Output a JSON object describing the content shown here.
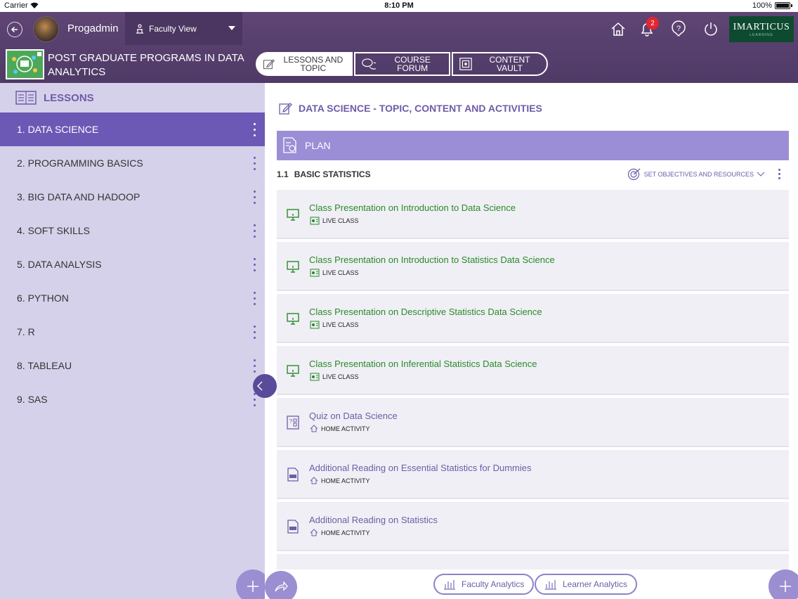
{
  "status_bar": {
    "carrier": "Carrier",
    "time": "8:10 PM",
    "battery": "100%"
  },
  "header": {
    "username": "Progadmin",
    "view_select": "Faculty View",
    "notification_count": "2",
    "logo_brand": "IMARTICUS",
    "logo_sub": "LEARNING",
    "program_title": "POST GRADUATE PROGRAMS IN DATA ANALYTICS",
    "tabs": [
      {
        "label": "LESSONS AND TOPIC",
        "active": true
      },
      {
        "label": "COURSE FORUM",
        "active": false
      },
      {
        "label": "CONTENT VAULT",
        "active": false
      }
    ]
  },
  "sidebar": {
    "title": "LESSONS",
    "items": [
      {
        "label": "1.  DATA SCIENCE",
        "active": true
      },
      {
        "label": "2. PROGRAMMING BASICS"
      },
      {
        "label": "3. BIG DATA AND HADOOP"
      },
      {
        "label": "4. SOFT SKILLS"
      },
      {
        "label": "5. DATA ANALYSIS"
      },
      {
        "label": "6. PYTHON"
      },
      {
        "label": "7.  R"
      },
      {
        "label": "8. TABLEAU"
      },
      {
        "label": "9. SAS"
      }
    ]
  },
  "main": {
    "title": "DATA SCIENCE - TOPIC, CONTENT AND ACTIVITIES",
    "plan_label": "PLAN",
    "topic": {
      "number": "1.1",
      "name": "BASIC STATISTICS",
      "objectives_label": "SET OBJECTIVES AND RESOURCES"
    },
    "activities": [
      {
        "title": "Class Presentation on Introduction to Data Science",
        "type": "LIVE CLASS",
        "kind": "live"
      },
      {
        "title": "Class Presentation on Introduction to Statistics Data Science",
        "type": "LIVE CLASS",
        "kind": "live"
      },
      {
        "title": "Class Presentation on Descriptive Statistics Data Science",
        "type": "LIVE CLASS",
        "kind": "live"
      },
      {
        "title": "Class Presentation on Inferential Statistics Data Science",
        "type": "LIVE CLASS",
        "kind": "live"
      },
      {
        "title": "Quiz on Data Science",
        "type": "HOME ACTIVITY",
        "kind": "quiz"
      },
      {
        "title": "Additional Reading on Essential Statistics for Dummies",
        "type": "HOME ACTIVITY",
        "kind": "pdf"
      },
      {
        "title": "Additional Reading on Statistics",
        "type": "HOME ACTIVITY",
        "kind": "pdf"
      }
    ]
  },
  "bottom": {
    "faculty_analytics": "Faculty Analytics",
    "learner_analytics": "Learner Analytics"
  },
  "colors": {
    "header": "#55406c",
    "accent": "#6c58b5",
    "sidebar_bg": "#d6d1ea",
    "plan_bar": "#9b8ed6",
    "live_text": "#2a8a2a"
  }
}
